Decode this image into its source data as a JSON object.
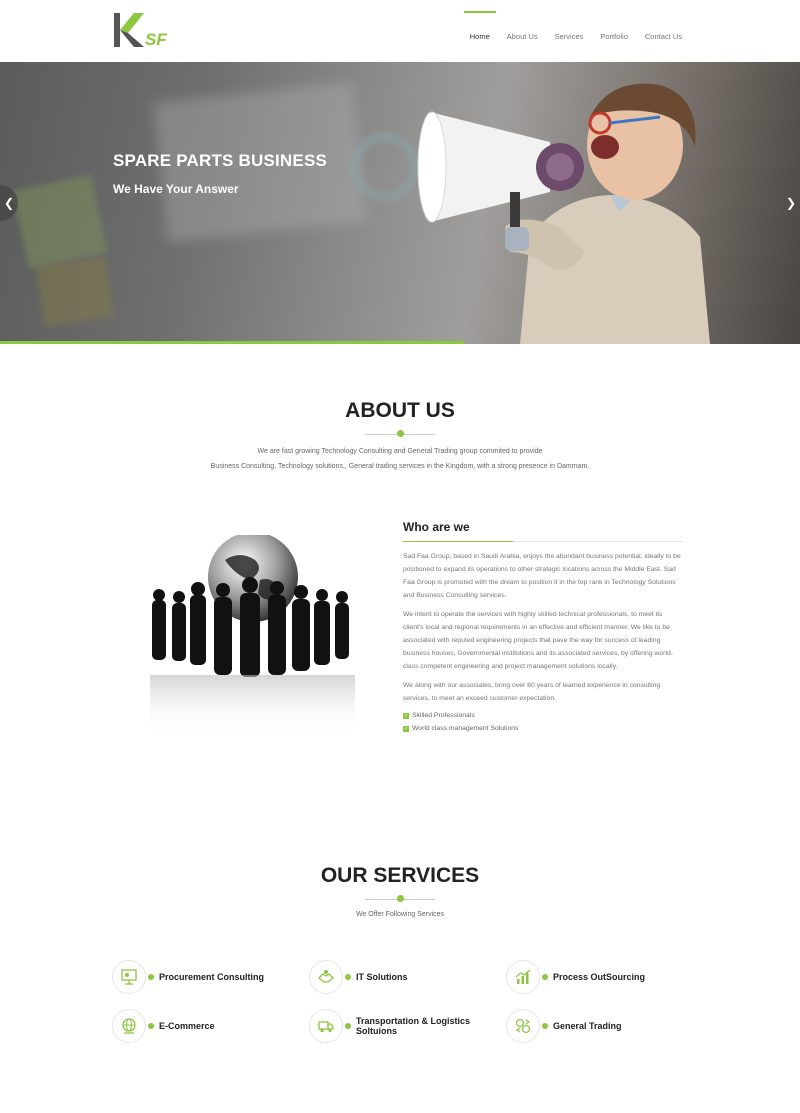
{
  "brand": {
    "logo_text": "SF",
    "accent": "#8dc63f"
  },
  "nav": {
    "items": [
      {
        "label": "Home",
        "active": true
      },
      {
        "label": "About Us",
        "active": false
      },
      {
        "label": "Services",
        "active": false
      },
      {
        "label": "Portfolio",
        "active": false
      },
      {
        "label": "Contact Us",
        "active": false
      }
    ]
  },
  "hero": {
    "title": "SPARE PARTS BUSINESS",
    "subtitle": "We Have Your Answer",
    "prev_icon": "chevron-left-icon",
    "next_icon": "chevron-right-icon",
    "progress": 0.58
  },
  "about": {
    "title": "ABOUT US",
    "line1": "We are fast growing Technology Consulting and General Trading group commited to provide",
    "line2": "Business Consulting, Technology solutions,, General trading services in the Kingdom, with a strong presence in Dammam."
  },
  "who": {
    "title": "Who are we",
    "paragraphs": [
      "Sad Faa Group, based in Saudi Arabia, enjoys the abundant business potential, ideally to be positioned to expand its operations to other strategic locations across the Middle East. Sad Faa Group is promoted with the dream to position it in the top rank in Technology Solutions and Business Consulting services.",
      "We intent to operate the services with highly skilled technical professionals, to meet its client's local and regional requirements in an effective and efficient manner. We like to be associated with reputed engineering projects that pave the way for success of leading business houses, Governmental institutions and its associated services, by offering world-class competent engineering and project management solutions locally.",
      "We along with our associates, bring over 80 years of learned experience in consulting services, to meet an exceed customer expectation."
    ],
    "checklist": [
      "Skilled Professionals",
      "World class management Solutions"
    ]
  },
  "services": {
    "title": "OUR SERVICES",
    "subtitle": "We Offer Following Services",
    "items": [
      {
        "label": "Procurement Consulting",
        "icon": "presentation-icon"
      },
      {
        "label": "IT Solutions",
        "icon": "handshake-icon"
      },
      {
        "label": "Process OutSourcing",
        "icon": "growth-chart-icon"
      },
      {
        "label": "E-Commerce",
        "icon": "globe-cart-icon"
      },
      {
        "label": "Transportation & Logistics Soltuions",
        "icon": "delivery-truck-icon"
      },
      {
        "label": "General Trading",
        "icon": "money-exchange-icon"
      }
    ]
  }
}
